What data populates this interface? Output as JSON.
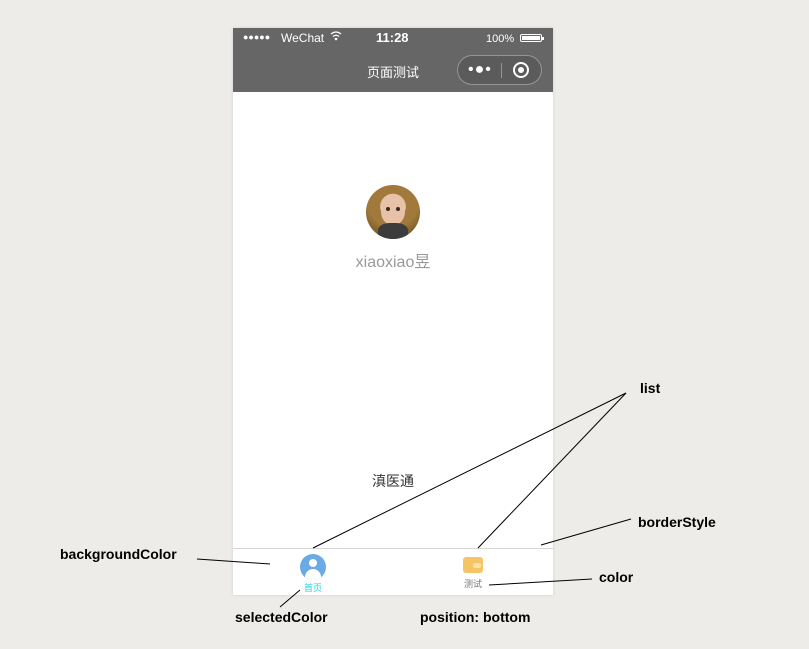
{
  "status_bar": {
    "signal": "●●●●●",
    "carrier": "WeChat",
    "wifi_icon": "wifi-icon",
    "time": "11:28",
    "battery": "100%"
  },
  "nav": {
    "title": "页面测试",
    "more_icon": "more-dots-icon",
    "close_icon": "record-close-icon",
    "background": "#666666"
  },
  "profile": {
    "username": "xiaoxiao昱"
  },
  "content": {
    "app_name": "滇医通"
  },
  "tab_bar": {
    "background": "#ffffff",
    "border_color": "#d6d6d6",
    "selected_color": "#17d7e8",
    "color": "#777777",
    "tabs": [
      {
        "label": "首页",
        "icon": "user-icon",
        "selected": true
      },
      {
        "label": "测试",
        "icon": "wallet-icon",
        "selected": false
      }
    ]
  },
  "annotations": {
    "list": "list",
    "border_style": "borderStyle",
    "background_color": "backgroundColor",
    "color": "color",
    "selected_color": "selectedColor",
    "position": "position: bottom"
  }
}
